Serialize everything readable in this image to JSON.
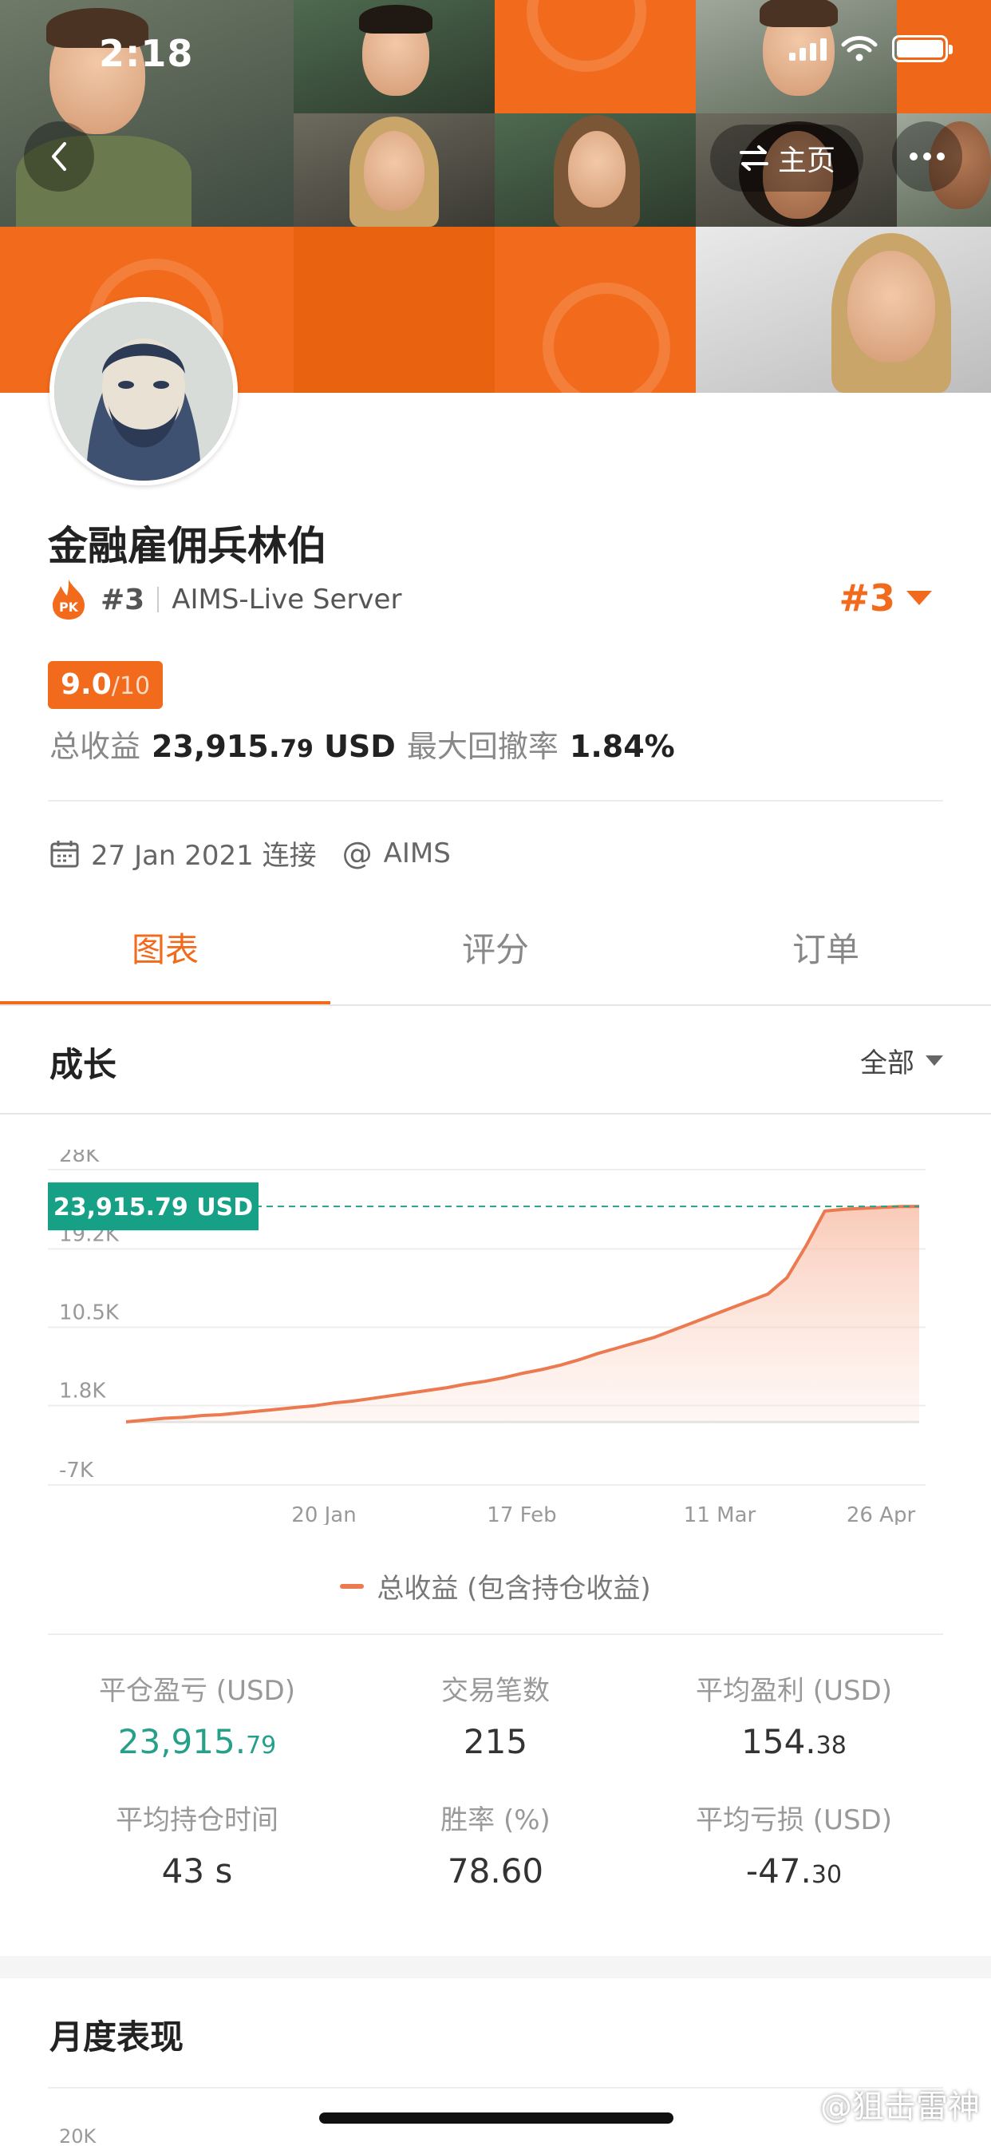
{
  "status_bar": {
    "time": "2:18"
  },
  "nav": {
    "home_label": "主页"
  },
  "profile": {
    "name": "金融雇佣兵林伯",
    "rank": "#3",
    "server": "AIMS-Live Server",
    "rank_right": "#3",
    "score": "9.0",
    "score_max": "/10",
    "total_profit_label": "总收益",
    "total_profit_main": "23,915.",
    "total_profit_dec": "79",
    "total_profit_unit": "USD",
    "drawdown_label": "最大回撤率",
    "drawdown_value": "1.84%",
    "connected_date": "27 Jan 2021 连接",
    "broker": "AIMS"
  },
  "tabs": [
    {
      "label": "图表",
      "active": true
    },
    {
      "label": "评分",
      "active": false
    },
    {
      "label": "订单",
      "active": false
    }
  ],
  "section": {
    "title": "成长",
    "filter": "全部"
  },
  "chart_data": {
    "type": "area",
    "ylim": [
      -7000,
      28000
    ],
    "y_ticks": [
      "28K",
      "19.2K",
      "10.5K",
      "1.8K",
      "-7K"
    ],
    "y_tick_values": [
      28000,
      19200,
      10500,
      1800,
      -7000
    ],
    "x_ticks": [
      "20 Jan",
      "17 Feb",
      "11 Mar",
      "26 Apr"
    ],
    "current_label": "23,915.79 USD",
    "current_value": 23915.79,
    "legend": "总收益 (包含持仓收益)",
    "series": [
      {
        "values": [
          0,
          200,
          400,
          500,
          700,
          800,
          1000,
          1200,
          1400,
          1600,
          1800,
          2100,
          2300,
          2600,
          2900,
          3200,
          3500,
          3800,
          4200,
          4500,
          4900,
          5400,
          5800,
          6300,
          6900,
          7600,
          8200,
          8800,
          9400,
          10200,
          11000,
          11800,
          12600,
          13400,
          14200,
          16000,
          19500,
          23400,
          23600,
          23700,
          23800,
          23900,
          23915.79
        ]
      }
    ]
  },
  "stats": [
    {
      "label": "平仓盈亏 (USD)",
      "main": "23,915.",
      "dec": "79",
      "color": "#27a08a"
    },
    {
      "label": "交易笔数",
      "main": "215",
      "dec": ""
    },
    {
      "label": "平均盈利 (USD)",
      "main": "154.",
      "dec": "38"
    },
    {
      "label": "平均持仓时间",
      "main": "43 s",
      "dec": ""
    },
    {
      "label": "胜率 (%)",
      "main": "78.60",
      "dec": ""
    },
    {
      "label": "平均亏损 (USD)",
      "main": "-47.",
      "dec": "30"
    }
  ],
  "monthly": {
    "title": "月度表现",
    "tick": "20K"
  },
  "watermark": "@狙击雷神",
  "colors": {
    "accent": "#f26a1b",
    "green": "#27a08a",
    "line": "#ec7a50"
  }
}
